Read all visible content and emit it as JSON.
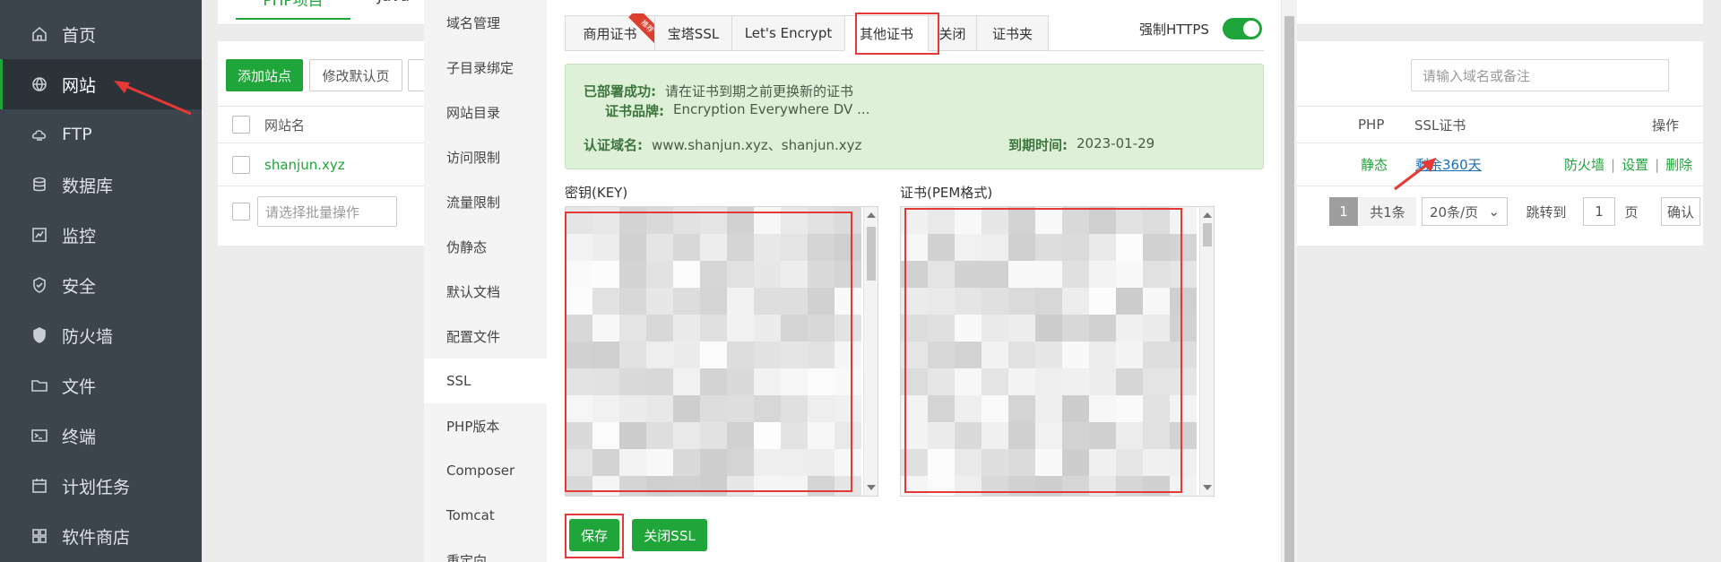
{
  "sidebar": {
    "items": [
      {
        "label": "首页",
        "icon": "home-icon"
      },
      {
        "label": "网站",
        "icon": "globe-icon"
      },
      {
        "label": "FTP",
        "icon": "ftp-icon"
      },
      {
        "label": "数据库",
        "icon": "database-icon"
      },
      {
        "label": "监控",
        "icon": "monitor-icon"
      },
      {
        "label": "安全",
        "icon": "shield-icon"
      },
      {
        "label": "防火墙",
        "icon": "firewall-shield-icon"
      },
      {
        "label": "文件",
        "icon": "folder-icon"
      },
      {
        "label": "终端",
        "icon": "terminal-icon"
      },
      {
        "label": "计划任务",
        "icon": "calendar-icon"
      },
      {
        "label": "软件商店",
        "icon": "grid-icon"
      }
    ],
    "active_index": 1
  },
  "background": {
    "tabs": [
      "PHP项目",
      "Java"
    ],
    "add_site_label": "添加站点",
    "modify_default_label": "修改默认页",
    "search_placeholder": "请输入域名或备注",
    "columns": {
      "site_name": "网站名",
      "php": "PHP",
      "ssl": "SSL证书",
      "actions": "操作"
    },
    "row": {
      "site_name": "shanjun.xyz",
      "php": "静态",
      "ssl": "剩余360天",
      "actions": [
        "防火墙",
        "设置",
        "删除"
      ]
    },
    "batch_placeholder": "请选择批量操作",
    "pager": {
      "current_page": "1",
      "total": "共1条",
      "per_page": "20条/页",
      "jump_label": "跳转到",
      "jump_value": "1",
      "page_unit": "页",
      "confirm": "确认"
    }
  },
  "modal": {
    "menu": [
      "域名管理",
      "子目录绑定",
      "网站目录",
      "访问限制",
      "流量限制",
      "伪静态",
      "默认文档",
      "配置文件",
      "SSL",
      "PHP版本",
      "Composer",
      "Tomcat",
      "重定向"
    ],
    "active_menu": "SSL",
    "ssl_tabs": [
      "商用证书",
      "宝塔SSL",
      "Let's Encrypt",
      "其他证书",
      "关闭",
      "证书夹"
    ],
    "active_ssl_tab": "其他证书",
    "ribbon_text": "推荐",
    "force_https_label": "强制HTTPS",
    "force_https_on": true,
    "info": {
      "deploy_label": "已部署成功:",
      "deploy_value": "请在证书到期之前更换新的证书",
      "brand_label": "证书品牌:",
      "brand_value": "Encryption Everywhere DV ...",
      "domain_label": "认证域名:",
      "domain_value": "www.shanjun.xyz、shanjun.xyz",
      "expire_label": "到期时间:",
      "expire_value": "2023-01-29"
    },
    "key_label": "密钥(KEY)",
    "cert_label": "证书(PEM格式)",
    "save_label": "保存",
    "close_ssl_label": "关闭SSL"
  },
  "colors": {
    "brand_green": "#20a53a",
    "annotation_red": "#e53935",
    "sidebar_bg": "#3c444d"
  }
}
